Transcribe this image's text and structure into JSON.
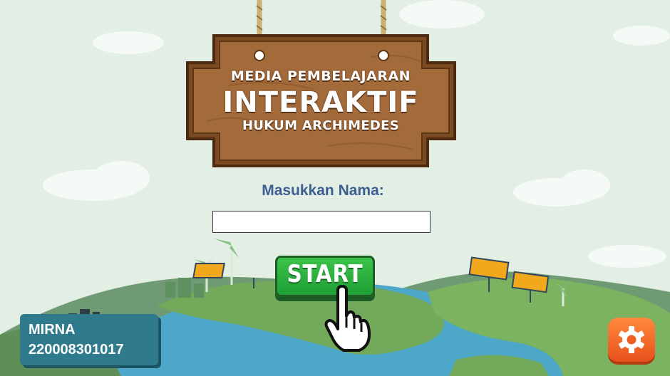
{
  "title_sign": {
    "line1": "MEDIA PEMBELAJARAN",
    "line2": "INTERAKTIF",
    "line3": "HUKUM ARCHIMEDES"
  },
  "form": {
    "name_label": "Masukkan Nama:",
    "name_value": "",
    "name_placeholder": ""
  },
  "start_button": {
    "label": "START"
  },
  "user_card": {
    "name": "MIRNA",
    "id": "220008301017"
  },
  "icons": {
    "pointer": "hand-pointer-icon",
    "settings": "gear-icon"
  },
  "colors": {
    "background": "#e3efe4",
    "wood": "#8e5a2e",
    "button_green": "#2fb040",
    "label_blue": "#3d5e91",
    "card_teal": "#2f7a8d",
    "settings_orange": "#f26a28"
  }
}
